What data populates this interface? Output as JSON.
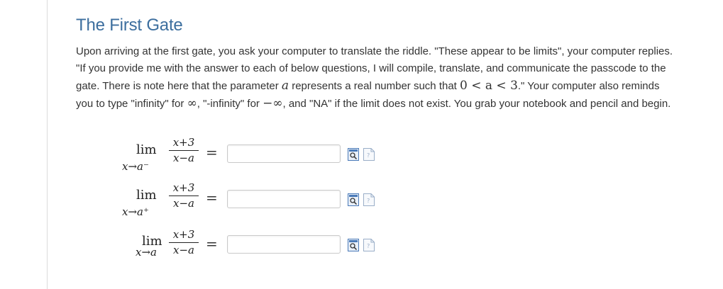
{
  "page": {
    "title": "The First Gate",
    "intro": {
      "p1": "Upon arriving at the first gate, you ask your computer to translate the riddle. \"These appear to be limits\", your computer replies. \"If you provide me with the answer to each of below questions, I will compile, translate, and communicate the passcode to the gate. There is note here that the parameter ",
      "param": "a",
      "p2": " represents a real number such that ",
      "ineq": "0 < a < 3",
      "p3": ".\" Your computer also reminds you to type \"infinity\" for ",
      "inf": "∞",
      "p4": ", \"-infinity\" for ",
      "neginf": "−∞",
      "p5": ", and \"NA\" if the limit does not exist. You grab your notebook and pencil and begin."
    }
  },
  "problems": [
    {
      "lim": "lim",
      "subscript": "x→a⁻",
      "numerator": "x+3",
      "denominator": "x−a",
      "equals": "=",
      "answer_value": "",
      "preview_icon": "preview-icon",
      "help_icon": "help-page-icon"
    },
    {
      "lim": "lim",
      "subscript": "x→a⁺",
      "numerator": "x+3",
      "denominator": "x−a",
      "equals": "=",
      "answer_value": "",
      "preview_icon": "preview-icon",
      "help_icon": "help-page-icon"
    },
    {
      "lim": "lim",
      "subscript": "x→a",
      "numerator": "x+3",
      "denominator": "x−a",
      "equals": "=",
      "answer_value": "",
      "preview_icon": "preview-icon",
      "help_icon": "help-page-icon"
    }
  ],
  "colors": {
    "title": "#3c6e9e",
    "text": "#333333",
    "input_border": "#c9c9c9",
    "icon_blue": "#4a7ab8"
  }
}
